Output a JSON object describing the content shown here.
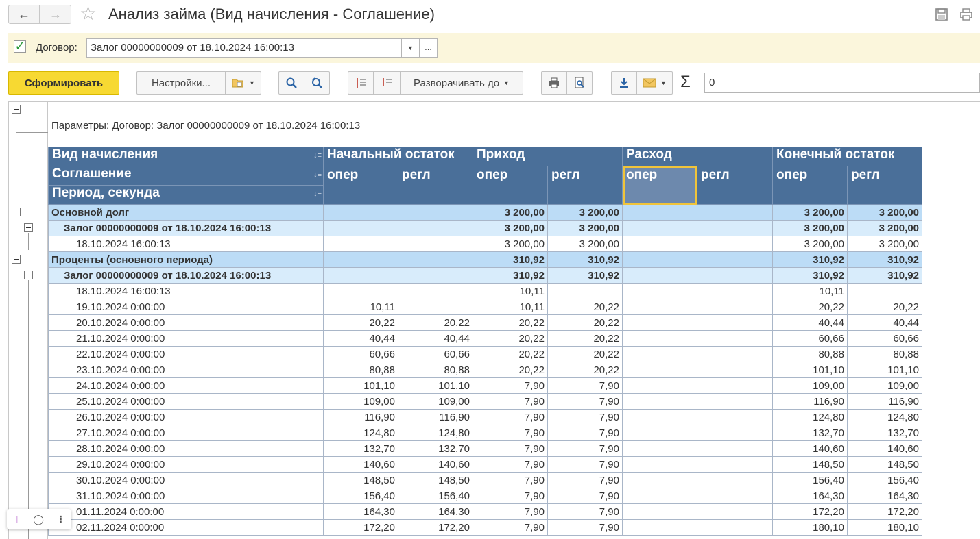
{
  "window": {
    "title": "Анализ займа (Вид начисления - Соглашение)"
  },
  "params": {
    "checkbox_checked": true,
    "label": "Договор:",
    "value": "Залог 00000000009 от 18.10.2024 16:00:13",
    "more": "..."
  },
  "toolbar": {
    "generate": "Сформировать",
    "settings": "Настройки...",
    "expand_to": "Разворачивать до",
    "sum_value": "0"
  },
  "report": {
    "params_line": "Параметры:   Договор: Залог 00000000009 от 18.10.2024 16:00:13",
    "headers": {
      "row_fields": [
        "Вид начисления",
        "Соглашение",
        "Период, секунда"
      ],
      "groups": [
        "Начальный остаток",
        "Приход",
        "Расход",
        "Конечный остаток"
      ],
      "subcols": [
        "опер",
        "регл"
      ]
    },
    "rows": [
      {
        "level": 1,
        "label": "Основной долг",
        "v": [
          "",
          "",
          "3 200,00",
          "3 200,00",
          "",
          "",
          "3 200,00",
          "3 200,00"
        ]
      },
      {
        "level": 2,
        "label": "Залог 00000000009 от 18.10.2024 16:00:13",
        "v": [
          "",
          "",
          "3 200,00",
          "3 200,00",
          "",
          "",
          "3 200,00",
          "3 200,00"
        ]
      },
      {
        "level": 3,
        "label": "18.10.2024 16:00:13",
        "v": [
          "",
          "",
          "3 200,00",
          "3 200,00",
          "",
          "",
          "3 200,00",
          "3 200,00"
        ]
      },
      {
        "level": 1,
        "label": "Проценты (основного периода)",
        "v": [
          "",
          "",
          "310,92",
          "310,92",
          "",
          "",
          "310,92",
          "310,92"
        ]
      },
      {
        "level": 2,
        "label": "Залог 00000000009 от 18.10.2024 16:00:13",
        "v": [
          "",
          "",
          "310,92",
          "310,92",
          "",
          "",
          "310,92",
          "310,92"
        ]
      },
      {
        "level": 3,
        "label": "18.10.2024 16:00:13",
        "v": [
          "",
          "",
          "10,11",
          "",
          "",
          "",
          "10,11",
          ""
        ]
      },
      {
        "level": 3,
        "label": "19.10.2024 0:00:00",
        "v": [
          "10,11",
          "",
          "10,11",
          "20,22",
          "",
          "",
          "20,22",
          "20,22"
        ]
      },
      {
        "level": 3,
        "label": "20.10.2024 0:00:00",
        "v": [
          "20,22",
          "20,22",
          "20,22",
          "20,22",
          "",
          "",
          "40,44",
          "40,44"
        ]
      },
      {
        "level": 3,
        "label": "21.10.2024 0:00:00",
        "v": [
          "40,44",
          "40,44",
          "20,22",
          "20,22",
          "",
          "",
          "60,66",
          "60,66"
        ]
      },
      {
        "level": 3,
        "label": "22.10.2024 0:00:00",
        "v": [
          "60,66",
          "60,66",
          "20,22",
          "20,22",
          "",
          "",
          "80,88",
          "80,88"
        ]
      },
      {
        "level": 3,
        "label": "23.10.2024 0:00:00",
        "v": [
          "80,88",
          "80,88",
          "20,22",
          "20,22",
          "",
          "",
          "101,10",
          "101,10"
        ]
      },
      {
        "level": 3,
        "label": "24.10.2024 0:00:00",
        "v": [
          "101,10",
          "101,10",
          "7,90",
          "7,90",
          "",
          "",
          "109,00",
          "109,00"
        ]
      },
      {
        "level": 3,
        "label": "25.10.2024 0:00:00",
        "v": [
          "109,00",
          "109,00",
          "7,90",
          "7,90",
          "",
          "",
          "116,90",
          "116,90"
        ]
      },
      {
        "level": 3,
        "label": "26.10.2024 0:00:00",
        "v": [
          "116,90",
          "116,90",
          "7,90",
          "7,90",
          "",
          "",
          "124,80",
          "124,80"
        ]
      },
      {
        "level": 3,
        "label": "27.10.2024 0:00:00",
        "v": [
          "124,80",
          "124,80",
          "7,90",
          "7,90",
          "",
          "",
          "132,70",
          "132,70"
        ]
      },
      {
        "level": 3,
        "label": "28.10.2024 0:00:00",
        "v": [
          "132,70",
          "132,70",
          "7,90",
          "7,90",
          "",
          "",
          "140,60",
          "140,60"
        ]
      },
      {
        "level": 3,
        "label": "29.10.2024 0:00:00",
        "v": [
          "140,60",
          "140,60",
          "7,90",
          "7,90",
          "",
          "",
          "148,50",
          "148,50"
        ]
      },
      {
        "level": 3,
        "label": "30.10.2024 0:00:00",
        "v": [
          "148,50",
          "148,50",
          "7,90",
          "7,90",
          "",
          "",
          "156,40",
          "156,40"
        ]
      },
      {
        "level": 3,
        "label": "31.10.2024 0:00:00",
        "v": [
          "156,40",
          "156,40",
          "7,90",
          "7,90",
          "",
          "",
          "164,30",
          "164,30"
        ]
      },
      {
        "level": 3,
        "label": "01.11.2024 0:00:00",
        "v": [
          "164,30",
          "164,30",
          "7,90",
          "7,90",
          "",
          "",
          "172,20",
          "172,20"
        ]
      },
      {
        "level": 3,
        "label": "02.11.2024 0:00:00",
        "v": [
          "172,20",
          "172,20",
          "7,90",
          "7,90",
          "",
          "",
          "180,10",
          "180,10"
        ]
      }
    ]
  },
  "icons": {
    "back": "arrow-left-icon",
    "forward": "arrow-right-icon",
    "favorite": "star-icon",
    "save": "floppy-icon",
    "print": "printer-icon"
  },
  "colors": {
    "header_bg": "#4a6f99",
    "group1_bg": "#bcdcf6",
    "group2_bg": "#d8ecfb",
    "primary_button": "#f7d932",
    "selection": "#f0c43a",
    "param_bar": "#fbf6dc"
  }
}
